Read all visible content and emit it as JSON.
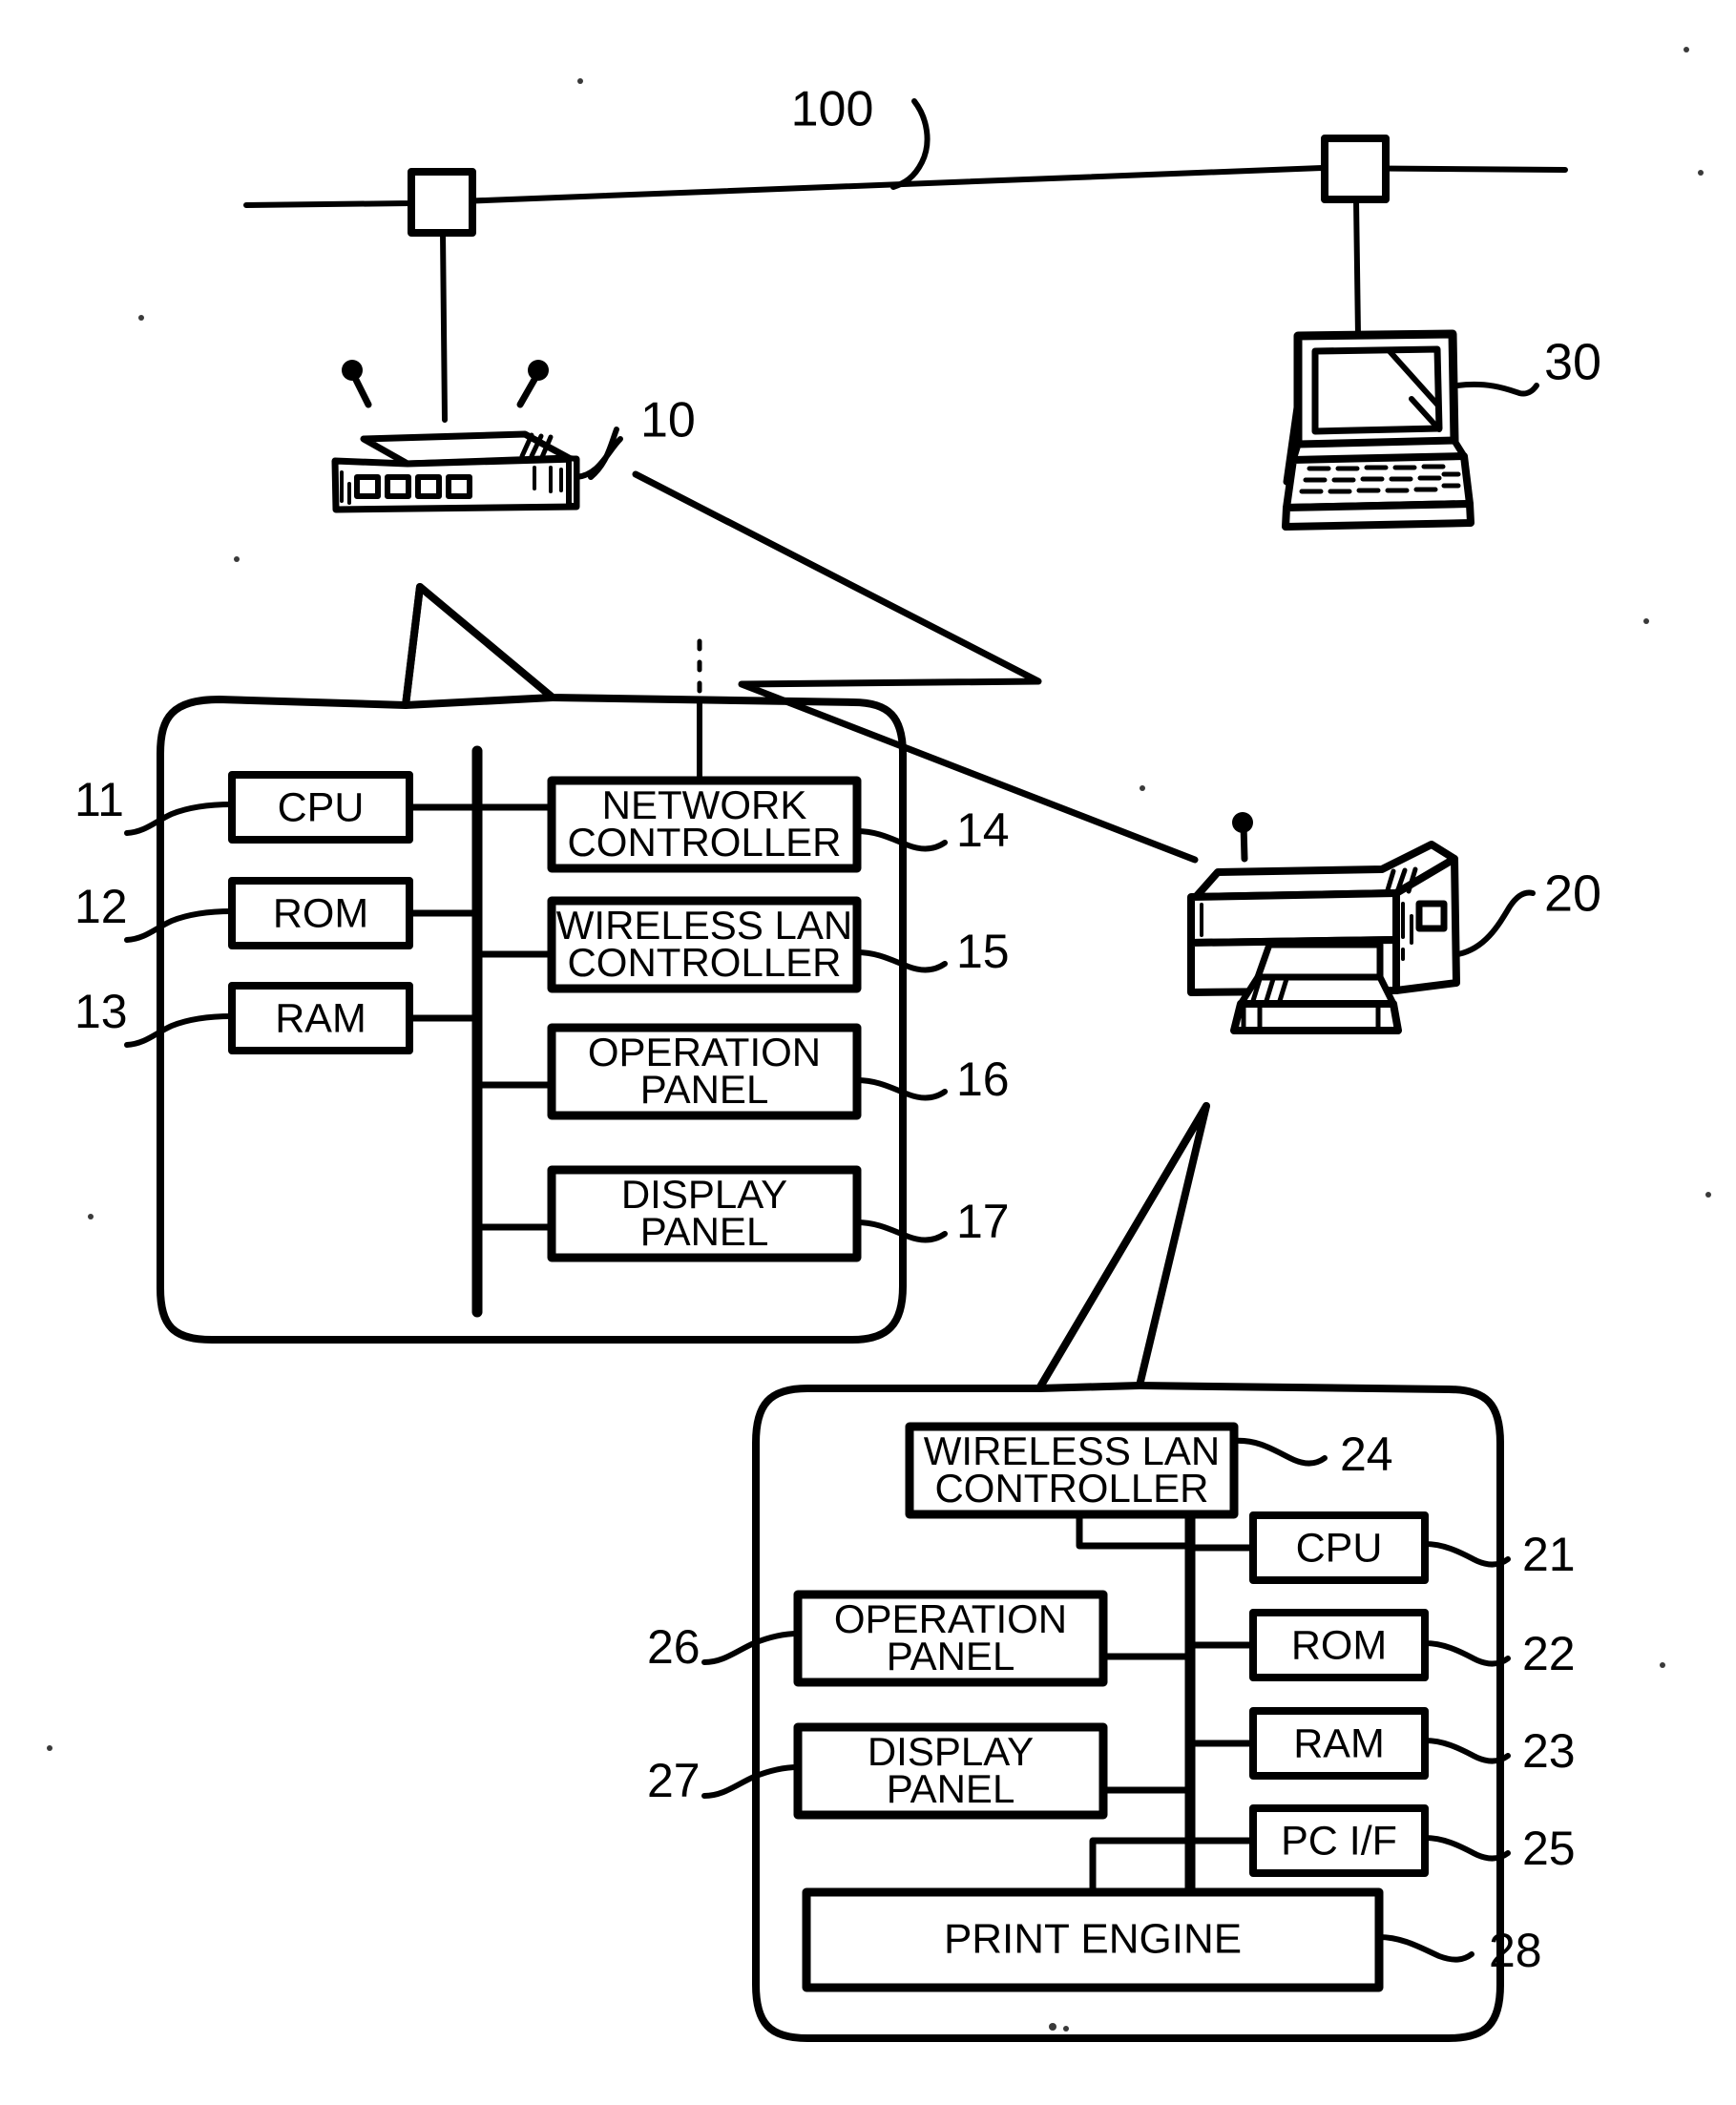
{
  "figure": {
    "title": "Network system block diagram",
    "background_color": "#ffffff",
    "line_color": "#000000"
  },
  "network": {
    "label": "100",
    "name": "network-backbone"
  },
  "devices": [
    {
      "id": "access-point",
      "ref": "10",
      "name": "wireless-access-point"
    },
    {
      "id": "laptop",
      "ref": "30",
      "name": "laptop-computer"
    },
    {
      "id": "printer",
      "ref": "20",
      "name": "wireless-printer"
    }
  ],
  "block_diagram_1": {
    "name": "access-point-internals",
    "left_column": [
      {
        "ref": "11",
        "label": "CPU"
      },
      {
        "ref": "12",
        "label": "ROM"
      },
      {
        "ref": "13",
        "label": "RAM"
      }
    ],
    "right_column": [
      {
        "ref": "14",
        "label": "NETWORK\nCONTROLLER",
        "line1": "NETWORK",
        "line2": "CONTROLLER"
      },
      {
        "ref": "15",
        "label": "WIRELESS LAN\nCONTROLLER",
        "line1": "WIRELESS LAN",
        "line2": "CONTROLLER"
      },
      {
        "ref": "16",
        "label": "OPERATION\nPANEL",
        "line1": "OPERATION",
        "line2": "PANEL"
      },
      {
        "ref": "17",
        "label": "DISPLAY\nPANEL",
        "line1": "DISPLAY",
        "line2": "PANEL"
      }
    ]
  },
  "block_diagram_2": {
    "name": "printer-internals",
    "top_block": {
      "ref": "24",
      "line1": "WIRELESS LAN",
      "line2": "CONTROLLER"
    },
    "left_column": [
      {
        "ref": "26",
        "line1": "OPERATION",
        "line2": "PANEL"
      },
      {
        "ref": "27",
        "line1": "DISPLAY",
        "line2": "PANEL"
      }
    ],
    "right_column": [
      {
        "ref": "21",
        "label": "CPU"
      },
      {
        "ref": "22",
        "label": "ROM"
      },
      {
        "ref": "23",
        "label": "RAM"
      },
      {
        "ref": "25",
        "label": "PC I/F"
      }
    ],
    "bottom_block": {
      "ref": "28",
      "label": "PRINT ENGINE"
    }
  }
}
